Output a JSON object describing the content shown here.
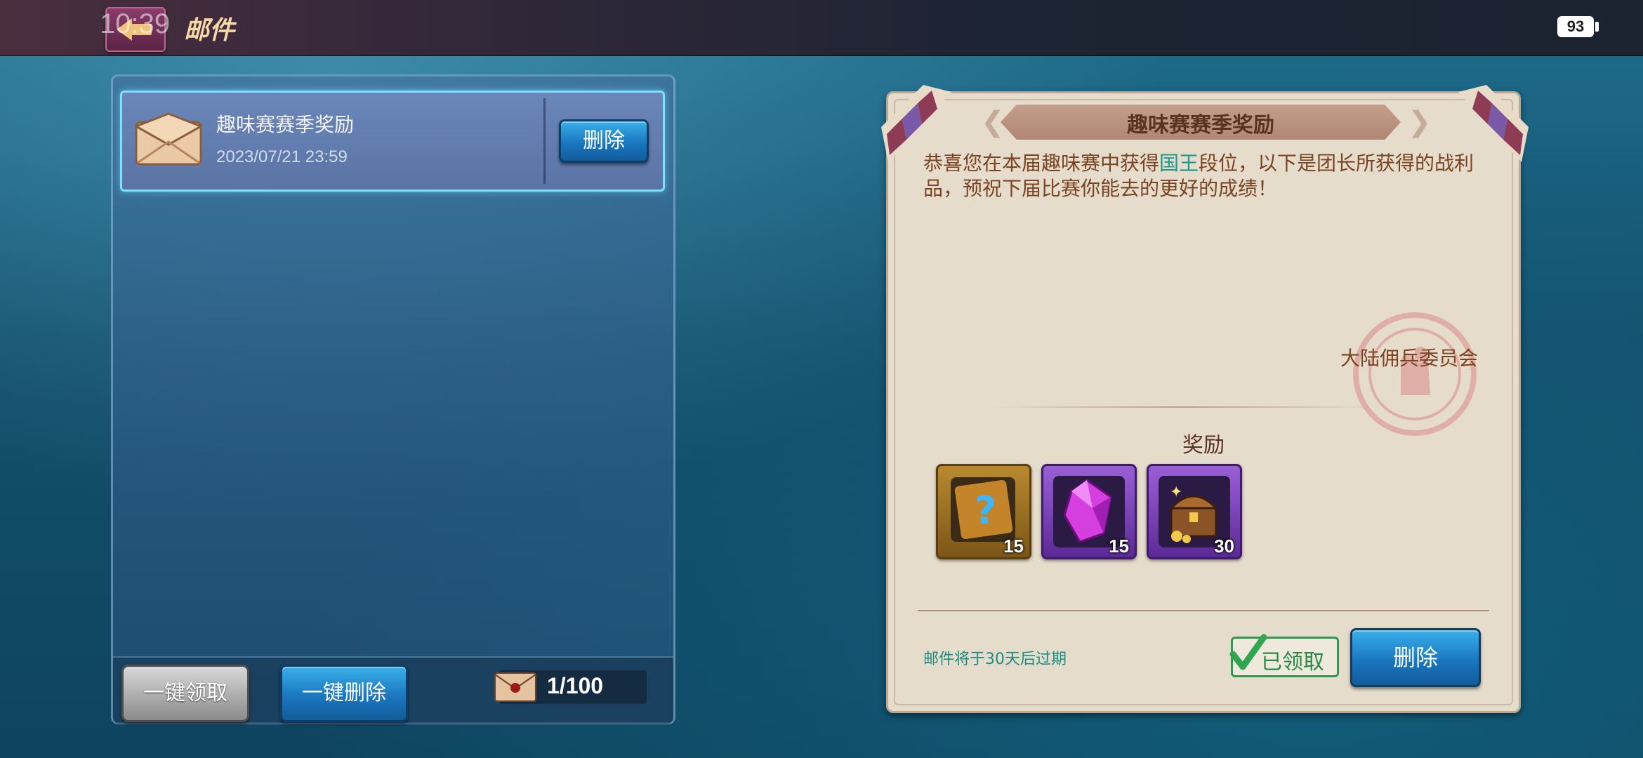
{
  "status_bar": {
    "time": "10:39",
    "battery": "93"
  },
  "header": {
    "title": "邮件"
  },
  "mail_list": {
    "items": [
      {
        "title": "趣味赛赛季奖励",
        "date": "2023/07/21 23:59",
        "delete_label": "删除"
      }
    ]
  },
  "footer": {
    "claim_all_label": "一键领取",
    "delete_all_label": "一键删除",
    "mail_count": "1/100"
  },
  "detail": {
    "title": "趣味赛赛季奖励",
    "message_before": "恭喜您在本届趣味赛中获得",
    "message_highlight": "国王",
    "message_after": "段位，以下是团长所获得的战利品，预祝下届比赛你能去的更好的成绩！",
    "sender": "大陆佣兵委员会",
    "rewards_label": "奖励",
    "rewards": [
      {
        "icon": "mystery-scroll-icon",
        "quantity": "15"
      },
      {
        "icon": "purple-gem-icon",
        "quantity": "15"
      },
      {
        "icon": "treasure-chest-icon",
        "quantity": "30"
      }
    ],
    "expire_text": "邮件将于30天后过期",
    "claimed_label": "已领取",
    "delete_label": "删除"
  },
  "colors": {
    "highlight": "#1a9b8b",
    "button_blue": "#1a77c0",
    "parchment": "#e6dccb"
  }
}
